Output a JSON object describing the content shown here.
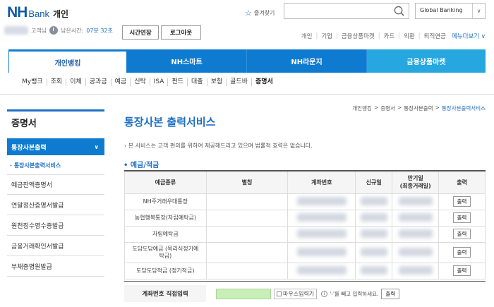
{
  "header": {
    "logo_nh": "NH",
    "logo_bank": "Bank",
    "logo_personal": "개인",
    "favorites": "즐겨찾기",
    "search_placeholder": "",
    "global": "Global Banking",
    "user_suffix": "고객님",
    "remaining_label": "남은시간:",
    "remaining_time": "07분 32초",
    "extend_btn": "시간연장",
    "logout_btn": "로그아웃",
    "util_links": [
      "개인",
      "기업",
      "금융상품마켓",
      "카드",
      "외환",
      "퇴직연금"
    ],
    "menu_more": "메뉴더보기"
  },
  "gnb": {
    "tabs": [
      "개인뱅킹",
      "NH스마트",
      "NH라운지",
      "금융상품마켓"
    ]
  },
  "sub_menu": [
    "My뱅크",
    "조회",
    "이체",
    "공과금",
    "예금",
    "신탁",
    "ISA",
    "펀드",
    "대출",
    "보험",
    "골드바",
    "증명서"
  ],
  "lnb": {
    "title": "증명서",
    "active": "통장사본출력",
    "active_sub": "· 통장사본출력서비스",
    "items": [
      "예금잔액증명서",
      "연말정산증명서발급",
      "원천징수영수증발급",
      "금융거래확인서발급",
      "부채증명원발급"
    ]
  },
  "breadcrumb": [
    "개인뱅킹",
    "증명서",
    "통장사본출력",
    "통장사본출력서비스"
  ],
  "page_title": "통장사본 출력서비스",
  "notice": "본 서비스는 고객 편의를 위하여 제공해드리고 있으며 법률적 효력은 없습니다.",
  "section_title": "예금/적금",
  "table": {
    "headers": [
      "예금종류",
      "별칭",
      "계좌번호",
      "신규일",
      "만기일\n(최종거래일)",
      "출력"
    ],
    "rows": [
      {
        "type": "NH주거래우대통장"
      },
      {
        "type": "농협행복통장(자립예탁금)"
      },
      {
        "type": "자립예탁금"
      },
      {
        "type": "도담도담예금 (목리식정기예탁금)"
      },
      {
        "type": "도담도담적금 (정기적금)"
      }
    ],
    "print_btn": "출력"
  },
  "direct": {
    "label": "계좌번호 직접입력",
    "keyboard": "마우스입력기",
    "info": "'-'를 빼고 입력하세요.",
    "print_btn": "출력"
  }
}
